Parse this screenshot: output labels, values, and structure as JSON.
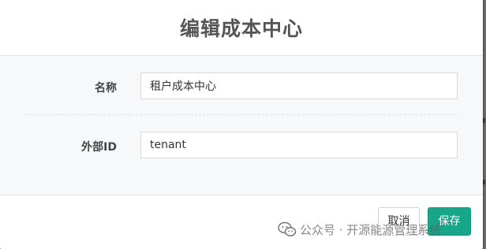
{
  "dialog": {
    "title": "编辑成本中心"
  },
  "form": {
    "name_label": "名称",
    "name_value": "租户成本中心",
    "external_id_label": "外部ID",
    "external_id_value": "tenant"
  },
  "footer": {
    "cancel_label": "取消",
    "save_label": "保存"
  },
  "watermark": {
    "text": "公众号 · 开源能源管理系统",
    "icon": "wechat-icon"
  },
  "colors": {
    "primary": "#18a689",
    "overlay": "#5f6062"
  }
}
